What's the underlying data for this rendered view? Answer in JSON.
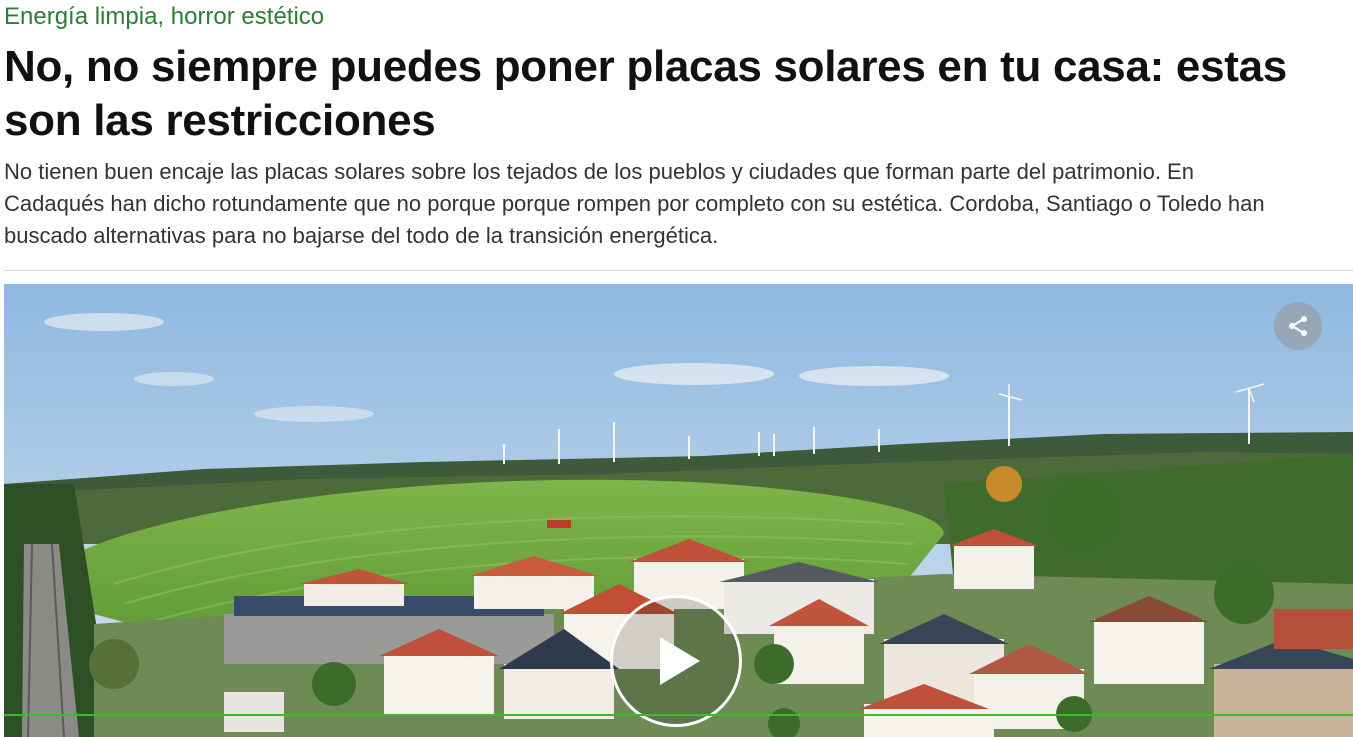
{
  "article": {
    "kicker": "Energía limpia, horror estético",
    "headline": "No, no siempre puedes poner placas solares en tu casa: estas son las restricciones",
    "dek": "No tienen buen encaje las placas solares sobre los tejados de los pueblos y ciudades que forman parte del patrimonio. En Cadaqués han dicho rotundamente que no porque porque rompen por completo con su estética. Cordoba, Santiago o Toledo han buscado alternativas para no bajarse del todo de la transición energética."
  },
  "video": {
    "share_icon": "share-icon",
    "play_icon": "play-icon",
    "progress_fraction": 1.0
  },
  "colors": {
    "kicker": "#2e7d32",
    "headline": "#111111",
    "dek": "#333333",
    "progress": "#3dbb2c"
  }
}
